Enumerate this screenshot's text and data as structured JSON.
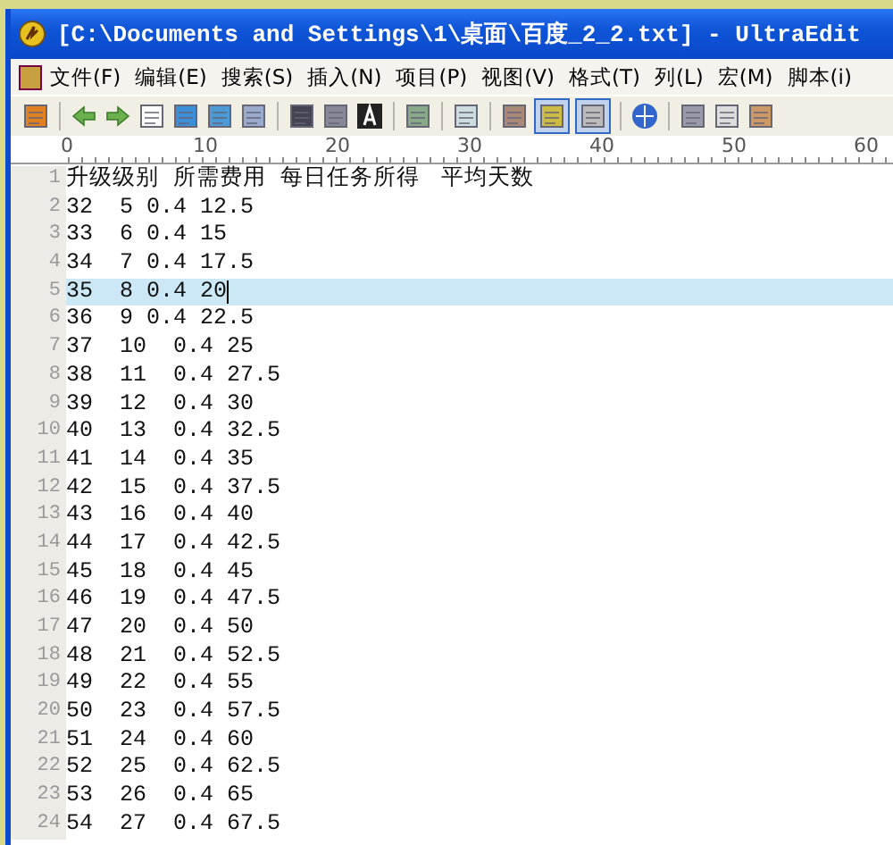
{
  "window": {
    "title": "[C:\\Documents and Settings\\1\\桌面\\百度_2_2.txt] - UltraEdit"
  },
  "menu": [
    "文件(F)",
    "编辑(E)",
    "搜索(S)",
    "插入(N)",
    "项目(P)",
    "视图(V)",
    "格式(T)",
    "列(L)",
    "宏(M)",
    "脚本(i)"
  ],
  "toolbar": [
    {
      "kind": "icon"
    },
    {
      "kind": "sep"
    },
    {
      "kind": "icon"
    },
    {
      "kind": "icon"
    },
    {
      "kind": "icon"
    },
    {
      "kind": "icon"
    },
    {
      "kind": "icon"
    },
    {
      "kind": "icon"
    },
    {
      "kind": "sep"
    },
    {
      "kind": "icon"
    },
    {
      "kind": "icon"
    },
    {
      "kind": "icon"
    },
    {
      "kind": "sep"
    },
    {
      "kind": "icon"
    },
    {
      "kind": "sep"
    },
    {
      "kind": "icon"
    },
    {
      "kind": "sep"
    },
    {
      "kind": "icon"
    },
    {
      "kind": "toggle",
      "on": true
    },
    {
      "kind": "toggle",
      "on": true
    },
    {
      "kind": "sep"
    },
    {
      "kind": "icon"
    },
    {
      "kind": "sep"
    },
    {
      "kind": "icon"
    },
    {
      "kind": "icon"
    },
    {
      "kind": "icon"
    }
  ],
  "ruler": [
    "0",
    "10",
    "20",
    "30",
    "40",
    "50",
    "60"
  ],
  "lines": [
    {
      "number": "1",
      "text": "升级级别\t所需费用\t每日任务所得\t平均天数",
      "selected": false
    },
    {
      "number": "2",
      "text": "32\t5 0.4 12.5",
      "selected": false
    },
    {
      "number": "3",
      "text": "33\t6 0.4 15",
      "selected": false
    },
    {
      "number": "4",
      "text": "34\t7 0.4 17.5",
      "selected": false
    },
    {
      "number": "5",
      "text": "35\t8 0.4 20",
      "selected": true
    },
    {
      "number": "6",
      "text": "36\t9 0.4 22.5",
      "selected": false
    },
    {
      "number": "7",
      "text": "37\t10\t0.4 25",
      "selected": false
    },
    {
      "number": "8",
      "text": "38\t11\t0.4 27.5",
      "selected": false
    },
    {
      "number": "9",
      "text": "39\t12\t0.4 30",
      "selected": false
    },
    {
      "number": "10",
      "text": "40\t13\t0.4 32.5",
      "selected": false
    },
    {
      "number": "11",
      "text": "41\t14\t0.4 35",
      "selected": false
    },
    {
      "number": "12",
      "text": "42\t15\t0.4 37.5",
      "selected": false
    },
    {
      "number": "13",
      "text": "43\t16\t0.4 40",
      "selected": false
    },
    {
      "number": "14",
      "text": "44\t17\t0.4 42.5",
      "selected": false
    },
    {
      "number": "15",
      "text": "45\t18\t0.4 45",
      "selected": false
    },
    {
      "number": "16",
      "text": "46\t19\t0.4 47.5",
      "selected": false
    },
    {
      "number": "17",
      "text": "47\t20\t0.4 50",
      "selected": false
    },
    {
      "number": "18",
      "text": "48\t21\t0.4 52.5",
      "selected": false
    },
    {
      "number": "19",
      "text": "49\t22\t0.4 55",
      "selected": false
    },
    {
      "number": "20",
      "text": "50\t23\t0.4 57.5",
      "selected": false
    },
    {
      "number": "21",
      "text": "51\t24\t0.4 60",
      "selected": false
    },
    {
      "number": "22",
      "text": "52\t25\t0.4 62.5",
      "selected": false
    },
    {
      "number": "23",
      "text": "53\t26\t0.4 65",
      "selected": false
    },
    {
      "number": "24",
      "text": "54\t27\t0.4 67.5",
      "selected": false
    }
  ]
}
